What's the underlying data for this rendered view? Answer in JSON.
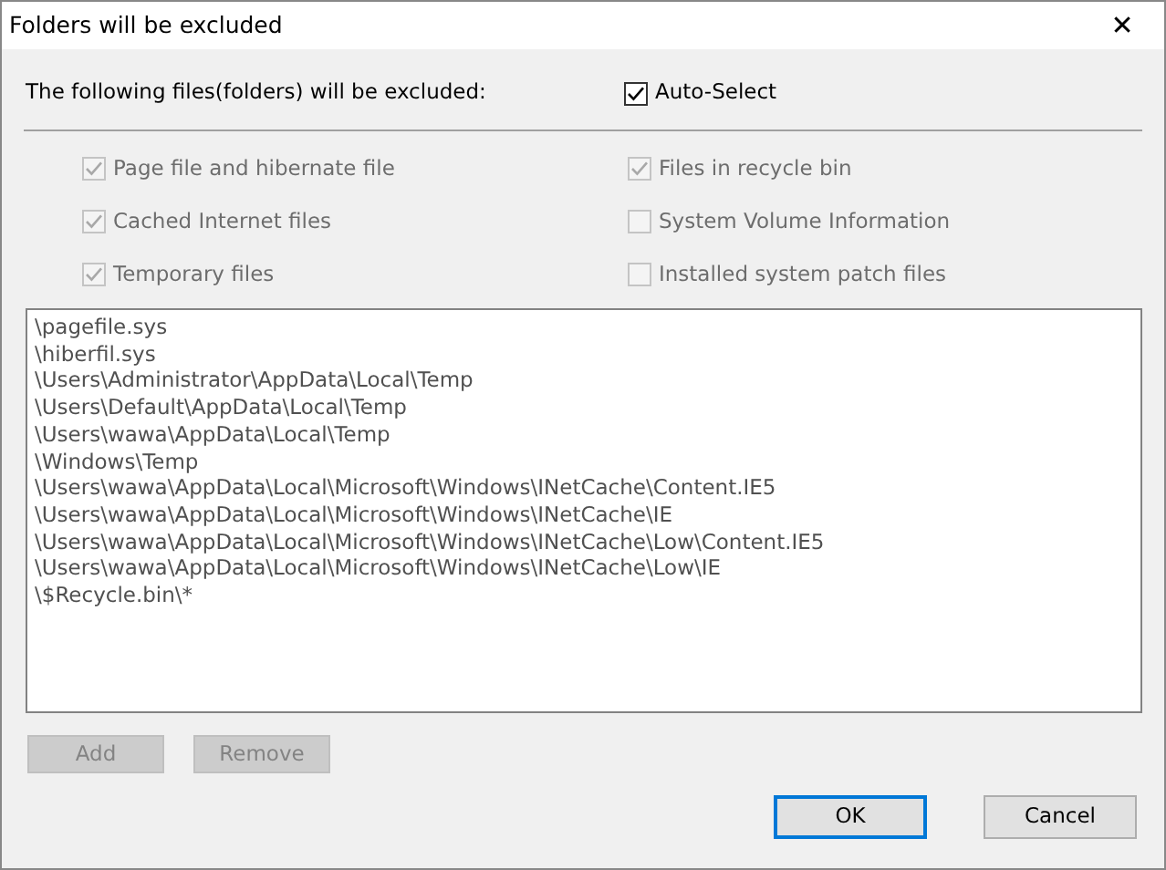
{
  "window": {
    "title": "Folders will be excluded",
    "close": "✕"
  },
  "heading": "The following files(folders) will be excluded:",
  "auto_select": {
    "label": "Auto-Select",
    "checked": true
  },
  "options": [
    {
      "label": "Page file and hibernate file",
      "checked": true,
      "disabled": true
    },
    {
      "label": "Files in recycle bin",
      "checked": true,
      "disabled": true
    },
    {
      "label": "Cached Internet files",
      "checked": true,
      "disabled": true
    },
    {
      "label": "System Volume Information",
      "checked": false,
      "disabled": true
    },
    {
      "label": "Temporary files",
      "checked": true,
      "disabled": true
    },
    {
      "label": "Installed system patch files",
      "checked": false,
      "disabled": true
    }
  ],
  "paths": [
    "\\pagefile.sys",
    "\\hiberfil.sys",
    "\\Users\\Administrator\\AppData\\Local\\Temp",
    "\\Users\\Default\\AppData\\Local\\Temp",
    "\\Users\\wawa\\AppData\\Local\\Temp",
    "\\Windows\\Temp",
    "\\Users\\wawa\\AppData\\Local\\Microsoft\\Windows\\INetCache\\Content.IE5",
    "\\Users\\wawa\\AppData\\Local\\Microsoft\\Windows\\INetCache\\IE",
    "\\Users\\wawa\\AppData\\Local\\Microsoft\\Windows\\INetCache\\Low\\Content.IE5",
    "\\Users\\wawa\\AppData\\Local\\Microsoft\\Windows\\INetCache\\Low\\IE",
    "\\$Recycle.bin\\*"
  ],
  "list_buttons": [
    {
      "label": "Add",
      "disabled": true
    },
    {
      "label": "Remove",
      "disabled": true
    }
  ],
  "dialog_buttons": [
    {
      "label": "OK",
      "default": true
    },
    {
      "label": "Cancel",
      "default": false
    }
  ]
}
